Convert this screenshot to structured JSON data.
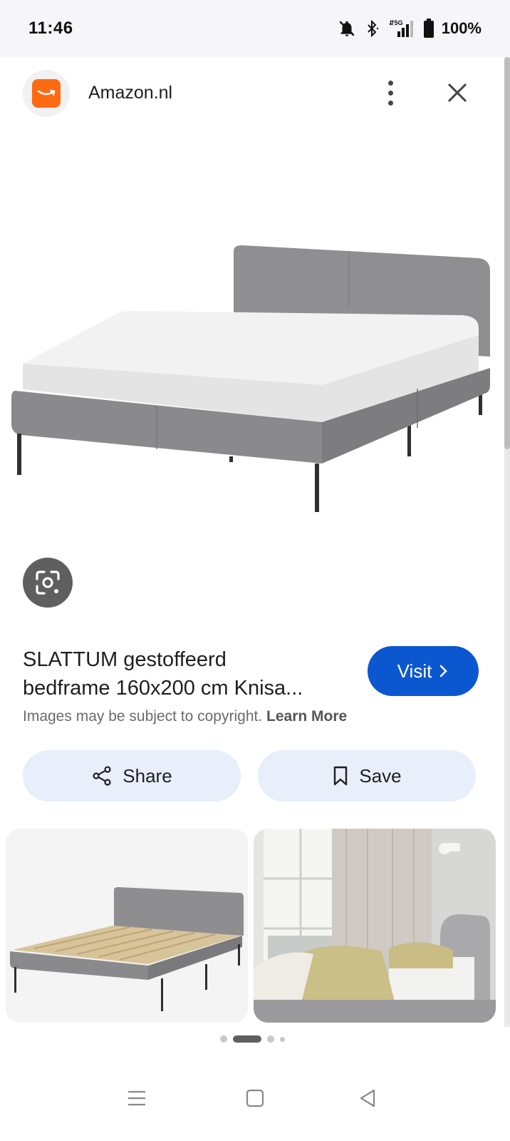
{
  "status_bar": {
    "time": "11:46",
    "battery_text": "100%",
    "icons": [
      "bell-off-icon",
      "bluetooth-icon",
      "signal-5g-icon",
      "battery-icon"
    ]
  },
  "header": {
    "site_name": "Amazon.nl",
    "logo_color": "#ff6a13",
    "menu_icon": "more-vert-icon",
    "close_icon": "close-icon"
  },
  "lens_icon": "google-lens-icon",
  "product": {
    "title_line1": "SLATTUM gestoffeerd",
    "title_line2": "bedframe 160x200 cm Knisa...",
    "copyright_text": "Images may be subject to copyright.",
    "learn_more": "Learn More"
  },
  "visit": {
    "label": "Visit",
    "color": "#0b57d0"
  },
  "actions": {
    "share_label": "Share",
    "save_label": "Save"
  },
  "pagination": {
    "count": 4,
    "active_index": 1
  },
  "nav": [
    "recent-apps-icon",
    "home-icon",
    "back-icon"
  ]
}
